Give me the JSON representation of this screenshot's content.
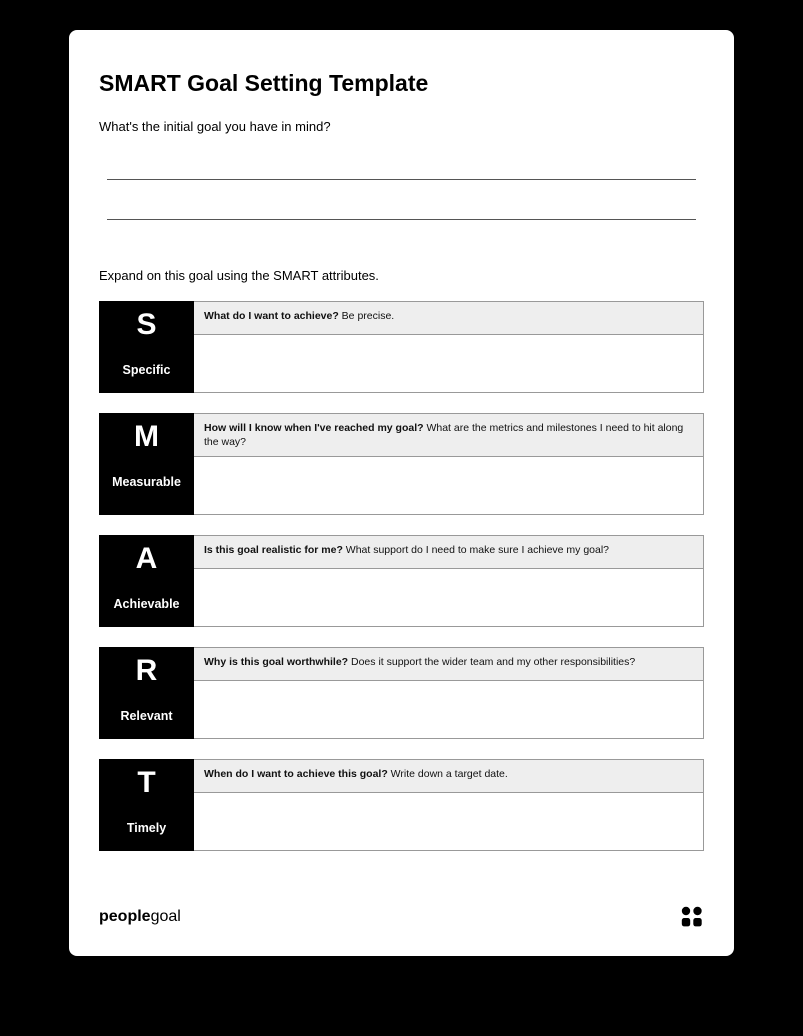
{
  "title": "SMART Goal Setting Template",
  "initial_prompt": "What's the initial goal you have in mind?",
  "expand_prompt": "Expand on this goal using the SMART attributes.",
  "rows": [
    {
      "letter": "S",
      "word": "Specific",
      "q_bold": "What do I want to achieve?",
      "q_rest": " Be precise."
    },
    {
      "letter": "M",
      "word": "Measurable",
      "q_bold": "How will I know when I've reached my goal?",
      "q_rest": " What are the metrics and milestones I need to hit along the way?"
    },
    {
      "letter": "A",
      "word": "Achievable",
      "q_bold": "Is this goal realistic for me?",
      "q_rest": " What support do I need to make sure I achieve my goal?"
    },
    {
      "letter": "R",
      "word": "Relevant",
      "q_bold": "Why is this goal worthwhile?",
      "q_rest": " Does it support the wider team and my other responsibilities?"
    },
    {
      "letter": "T",
      "word": "Timely",
      "q_bold": "When do I want to achieve this goal?",
      "q_rest": " Write down a target date."
    }
  ],
  "footer": {
    "brand_bold": "people",
    "brand_light": "goal"
  }
}
